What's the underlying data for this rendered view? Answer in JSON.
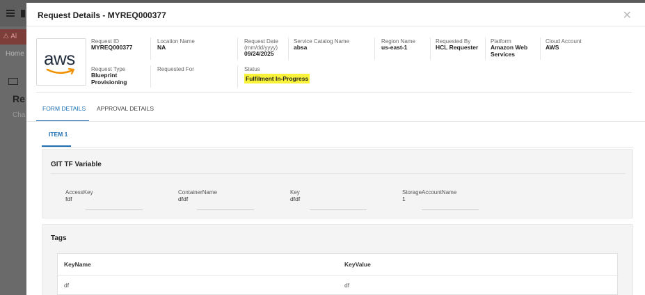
{
  "background": {
    "alert_text": "⚠ Al",
    "home_text": "Home",
    "heading_text": "Re",
    "sub_text": "Cha"
  },
  "modal": {
    "title": "Request Details - MYREQ000377",
    "close_glyph": "✕"
  },
  "logo": {
    "text": "aws"
  },
  "details": {
    "request_id": {
      "label": "Request ID",
      "value": "MYREQ000377"
    },
    "location_name": {
      "label": "Location Name",
      "value": "NA"
    },
    "request_date": {
      "label": "Request Date",
      "format": "(mm/dd/yyyy)",
      "value": "09/24/2025"
    },
    "service_catalog_name": {
      "label": "Service Catalog Name",
      "value": "absa"
    },
    "region_name": {
      "label": "Region Name",
      "value": "us-east-1"
    },
    "requested_by": {
      "label": "Requested By",
      "value": "HCL Requester"
    },
    "platform": {
      "label": "Platform",
      "value_line1": "Amazon Web",
      "value_line2": "Services"
    },
    "cloud_account": {
      "label": "Cloud Account",
      "value": "AWS"
    },
    "request_type": {
      "label": "Request Type",
      "value_line1": "Blueprint",
      "value_line2": "Provisioning"
    },
    "requested_for": {
      "label": "Requested For",
      "value": ""
    },
    "status": {
      "label": "Status",
      "value": "Fulfilment In-Progress",
      "highlight_color": "#f8f33a"
    }
  },
  "tabs": [
    {
      "label": "FORM DETAILS",
      "active": true
    },
    {
      "label": "APPROVAL DETAILS",
      "active": false
    }
  ],
  "item_tab": {
    "label": "ITEM 1"
  },
  "git_tf": {
    "title": "GIT TF Variable",
    "variables": [
      {
        "label": "AccessKey",
        "value": "fdf"
      },
      {
        "label": "ContainerName",
        "value": "dfdf"
      },
      {
        "label": "Key",
        "value": "dfdf"
      },
      {
        "label": "StorageAccountName",
        "value": "1"
      }
    ]
  },
  "tags": {
    "title": "Tags",
    "columns": [
      "KeyName",
      "KeyValue"
    ],
    "rows": [
      [
        "df",
        "df"
      ]
    ]
  },
  "colors": {
    "accent": "#1f6fb2",
    "status_highlight": "#f8f33a"
  }
}
